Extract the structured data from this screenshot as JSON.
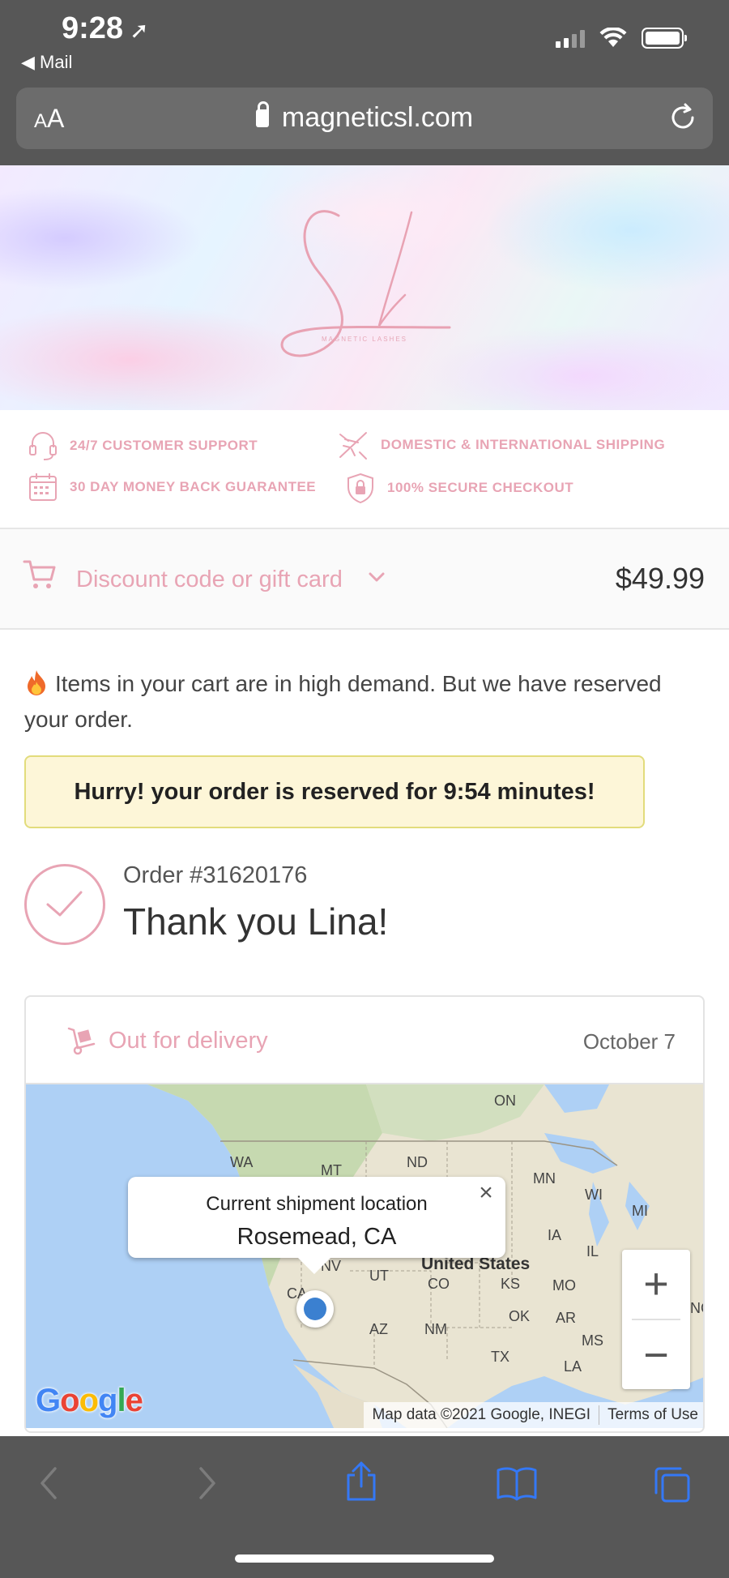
{
  "status_bar": {
    "time": "9:28",
    "back_app": "◀ Mail"
  },
  "browser": {
    "text_size_label": "AA",
    "url": "magneticsl.com"
  },
  "banner": {
    "brand_tagline": "MAGNETIC LASHES"
  },
  "features": [
    {
      "icon": "headset-icon",
      "label": "24/7 CUSTOMER SUPPORT"
    },
    {
      "icon": "plane-icon",
      "label": "DOMESTIC & INTERNATIONAL SHIPPING"
    },
    {
      "icon": "calendar-icon",
      "label": "30 DAY MONEY BACK GUARANTEE"
    },
    {
      "icon": "shield-lock-icon",
      "label": "100% SECURE CHECKOUT"
    }
  ],
  "summary": {
    "discount_label": "Discount code or gift card",
    "total": "$49.99"
  },
  "demand_message": "Items in your cart are in high demand. But we have reserved your order.",
  "reservation_message": "Hurry! your order is reserved for 9:54 minutes!",
  "order": {
    "number": "Order #31620176",
    "thanks": "Thank you Lina!"
  },
  "delivery": {
    "status": "Out for delivery",
    "date": "October 7",
    "popup_title": "Current shipment location",
    "popup_city": "Rosemead, CA",
    "country_label": "United States",
    "states": [
      "ON",
      "WA",
      "MT",
      "ND",
      "MN",
      "WI",
      "MI",
      "IA",
      "IL",
      "NV",
      "UT",
      "CO",
      "KS",
      "MO",
      "OK",
      "AR",
      "AZ",
      "NM",
      "TX",
      "MS",
      "LA",
      "CA",
      "NC"
    ],
    "map_data": "Map data ©2021 Google, INEGI",
    "terms": "Terms of Use",
    "google_logo": "Google"
  },
  "colors": {
    "brand_pink": "#e8a4b4",
    "chrome_gray": "#575757",
    "ios_blue": "#3478f6",
    "hurry_bg": "#fdf6d8"
  }
}
